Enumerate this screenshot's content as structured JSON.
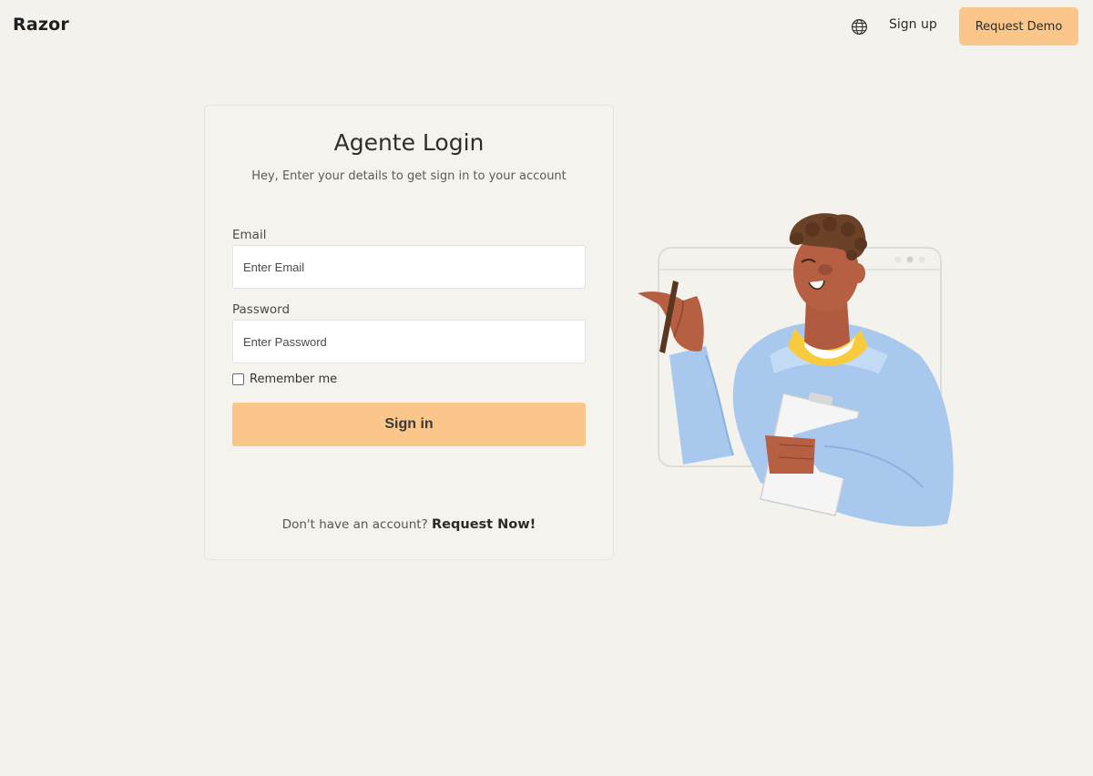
{
  "header": {
    "brand": "Razor",
    "signup_label": "Sign up",
    "demo_label": "Request Demo",
    "language_icon": "globe-icon"
  },
  "login": {
    "title": "Agente Login",
    "subtitle": "Hey, Enter your details to get sign in to your account",
    "email_label": "Email",
    "email_placeholder": "Enter Email",
    "password_label": "Password",
    "password_placeholder": "Enter Password",
    "remember_label": "Remember me",
    "remember_checked": false,
    "signin_label": "Sign in",
    "no_account_text": "Don't have an account?",
    "request_link": "Request Now!"
  },
  "colors": {
    "background": "#f4f2ec",
    "accent": "#fbc68a",
    "text": "#2e2e2e"
  }
}
